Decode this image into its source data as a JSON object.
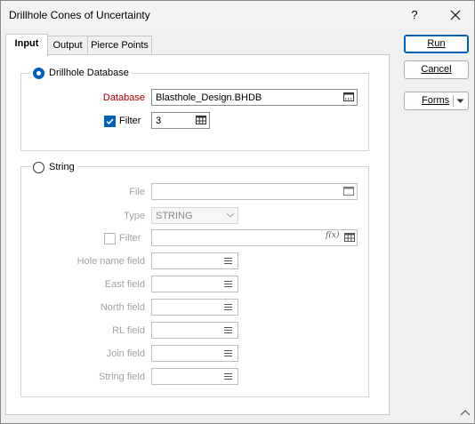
{
  "window": {
    "title": "Drillhole Cones of Uncertainty",
    "help_label": "?"
  },
  "tabs": [
    {
      "label": "Input",
      "active": true
    },
    {
      "label": "Output",
      "active": false
    },
    {
      "label": "Pierce Points",
      "active": false
    }
  ],
  "drillhole_group": {
    "label": "Drillhole Database",
    "selected": true,
    "database_label": "Database",
    "database_value": "Blasthole_Design.BHDB",
    "filter_label": "Filter",
    "filter_checked": true,
    "filter_value": "3"
  },
  "string_group": {
    "label": "String",
    "selected": false,
    "file_label": "File",
    "file_value": "",
    "type_label": "Type",
    "type_value": "STRING",
    "filter_label": "Filter",
    "filter_checked": false,
    "fx_glyph": "f(x)",
    "fields": [
      {
        "label": "Hole name field",
        "value": ""
      },
      {
        "label": "East field",
        "value": ""
      },
      {
        "label": "North field",
        "value": ""
      },
      {
        "label": "RL field",
        "value": ""
      },
      {
        "label": "Join field",
        "value": ""
      },
      {
        "label": "String field",
        "value": ""
      }
    ]
  },
  "buttons": {
    "run": "Run",
    "cancel": "Cancel",
    "forms": "Forms"
  },
  "colors": {
    "accent": "#005fb8",
    "required_label": "#b00000",
    "disabled_text": "#a2a2a2"
  },
  "icons": [
    "close-icon",
    "browse-icon",
    "table-icon",
    "list-icon",
    "chevron-down-icon",
    "fx-icon",
    "resize-grip-icon"
  ]
}
